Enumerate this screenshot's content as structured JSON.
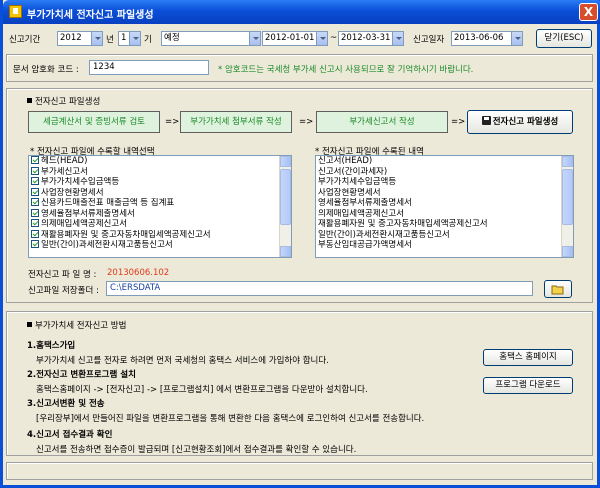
{
  "window": {
    "title": "부가가치세 전자신고 파일생성",
    "close": "X"
  },
  "filter": {
    "period_label": "신고기간",
    "year_value": "2012",
    "year_unit": "년",
    "term_value": "1",
    "term_unit": "기",
    "type_value": "예정",
    "start_date": "2012-01-01",
    "date_sep": "~",
    "end_date": "2012-03-31",
    "report_date_label": "신고일자",
    "report_date": "2013-06-06",
    "close_button": "닫기(ESC)"
  },
  "password": {
    "label": "문서 암호화 코드 :",
    "value": "1234",
    "hint": "* 암호코드는 국세청 부가세 신고시 사용되므로 잘 기억하시기 바랍니다."
  },
  "create_section": {
    "title": "전자신고 파일생성",
    "steps": [
      "세금계산서 및 증빙서류 검토",
      "부가가치세 첨부서류 작성",
      "부가세신고서 작성"
    ],
    "arrow": "=>",
    "create_button": "전자신고 파일생성",
    "left_list_title": "* 전자신고 파일에 수록할 내역선택",
    "left_items": [
      "헤드(HEAD)",
      "부가세신고서",
      "부가가치세수입금액등",
      "사업장현황명세서",
      "신용카드매출전표 매출금액 등 집계표",
      "영세율첨부서류제출명세서",
      "의제매입세액공제신고서",
      "재활용폐자원 및 중고자동차매입세액공제신고서",
      "일반(간이)과세전환시재고품등신고서"
    ],
    "right_list_title": "* 전자신고 파일에 수록된 내역",
    "right_items": [
      "신고서(HEAD)",
      "신고서(간이과세자)",
      "부가가치세수입금액등",
      "사업장현황명세서",
      "영세율첨부서류제출명세서",
      "의제매입세액공제신고서",
      "재활용폐자원 및 중고자동차매입세액공제신고서",
      "일반(간이)과세전환시재고품등신고서",
      "부동산임대공급가액명세서"
    ],
    "file_name_label": "전자신고 파 일 명 :",
    "file_name_value": "20130606.102",
    "folder_label": "신고파일 저장폴더 :",
    "folder_value": "C:\\ERSDATA"
  },
  "guide": {
    "title": "부가가치세 전자신고 방법",
    "steps": [
      {
        "heading": "1.홈택스가입",
        "desc": "부가가치세 신고를 전자로 하려면 먼저 국세청의 홈택스 서비스에 가입하야 합니다.",
        "button": "홈택스 홈페이지"
      },
      {
        "heading": "2.전자신고 변환프로그램 설치",
        "desc": "홈택스홈페이지 -> [전자신고] -> [프로그램설치] 에서 변환프로그램을 다운받아 설치합니다.",
        "button": "프로그램 다운로드"
      },
      {
        "heading": "3.신고서변환 및 전송",
        "desc": "[우리장부]에서 만들어진 파일을 변환프로그램을 통해 변환한 다음 홈택스에 로그인하여 신고서를 전송합니다."
      },
      {
        "heading": "4.신고서 접수결과 확인",
        "desc": "신고서를 전송하면 접수증이 발급되며 [신고현황조회]에서 접수결과를 확인할 수 있습니다."
      }
    ]
  }
}
